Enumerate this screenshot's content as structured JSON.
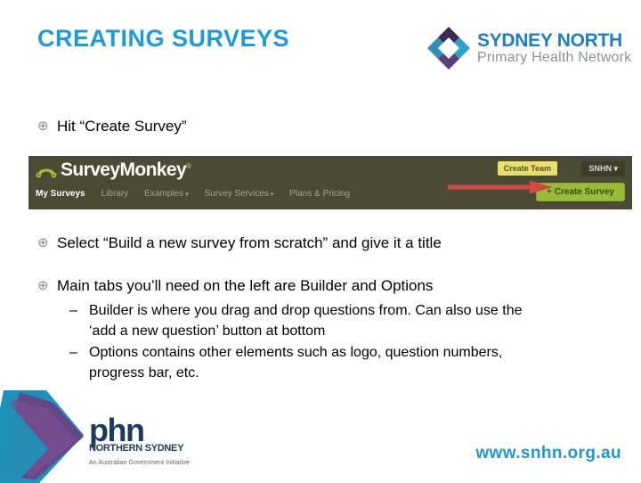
{
  "slide": {
    "title": "CREATING SURVEYS"
  },
  "header_logo": {
    "name": "sydney-north-phn-logo",
    "line1": "SYDNEY NORTH",
    "line2": "Primary Health Network",
    "mark_colors": {
      "teal": "#2aa3c7",
      "blue": "#1f7fc0",
      "purple": "#5b3b78",
      "dark_purple": "#3c2a54"
    }
  },
  "bullets": [
    {
      "glyph": "⊕",
      "text": "Hit “Create Survey”"
    },
    {
      "glyph": "⊕",
      "text": "Select “Build a new survey from scratch” and give it a title"
    },
    {
      "glyph": "⊕",
      "text": "Main tabs you’ll need on the left are Builder and Options"
    }
  ],
  "sub_bullets": [
    {
      "dash": "–",
      "text": "Builder is where you drag and drop questions from. Can also use the ‘add a new question’ button at bottom"
    },
    {
      "dash": "–",
      "text": "Options contains other elements such as logo, question numbers, progress bar, etc."
    }
  ],
  "surveymonkey": {
    "brand": "Survey",
    "brand2": "Monkey",
    "registered": "®",
    "nav": [
      {
        "label": "My Surveys",
        "active": true,
        "caret": false
      },
      {
        "label": "Library",
        "active": false,
        "caret": false
      },
      {
        "label": "Examples",
        "active": false,
        "caret": true
      },
      {
        "label": "Survey Services",
        "active": false,
        "caret": true
      },
      {
        "label": "Plans & Pricing",
        "active": false,
        "caret": false
      }
    ],
    "create_team_label": "Create Team",
    "account_label": "SNHN",
    "account_caret": "▾",
    "create_survey_label": "+ Create Survey",
    "caret": "▾",
    "colors": {
      "bar_bg": "#4b4b35",
      "create_team_bg": "#e8e06a",
      "create_survey_bg": "#9aba3a",
      "arrow": "#d04a42"
    }
  },
  "footer": {
    "phn_word": "phn",
    "phn_region": "NORTHERN SYDNEY",
    "phn_tagline": "An Australian Government Initiative",
    "url": "www.snhn.org.au",
    "accent_teal": "#1d91b8",
    "accent_purple": "#6b4083"
  }
}
